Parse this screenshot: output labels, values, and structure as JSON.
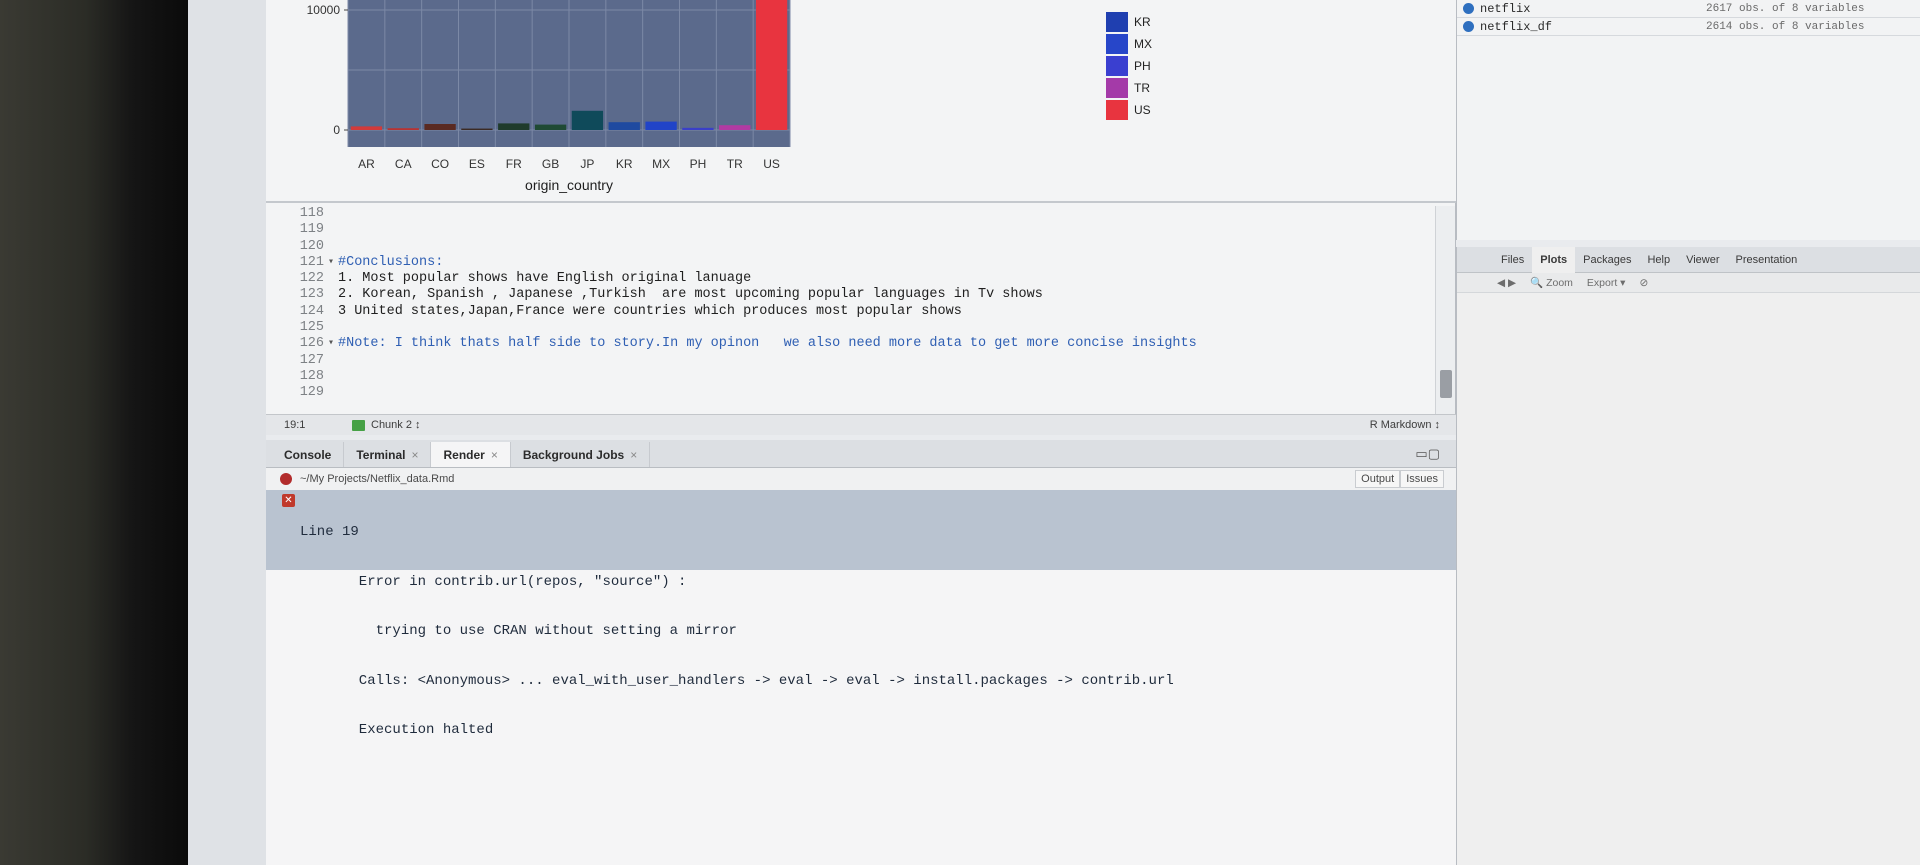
{
  "plot": {
    "y_ticks": [
      "10000",
      "0"
    ],
    "x_label": "origin_country",
    "legend": [
      {
        "code": "KR",
        "color": "#1f3fb0"
      },
      {
        "code": "MX",
        "color": "#2746c9"
      },
      {
        "code": "PH",
        "color": "#3a3fd0"
      },
      {
        "code": "TR",
        "color": "#a43aa8"
      },
      {
        "code": "US",
        "color": "#e8343f"
      }
    ]
  },
  "chart_data": {
    "type": "bar",
    "categories": [
      "AR",
      "CA",
      "CO",
      "ES",
      "FR",
      "GB",
      "JP",
      "KR",
      "MX",
      "PH",
      "TR",
      "US"
    ],
    "values": [
      300,
      150,
      500,
      120,
      550,
      450,
      1600,
      650,
      700,
      180,
      400,
      19000
    ],
    "colors": [
      "#d33a3a",
      "#b83333",
      "#5a2a22",
      "#3b2a24",
      "#1f3b2c",
      "#1f4a34",
      "#0f4a5a",
      "#1f4aa0",
      "#2144c8",
      "#3a3fc8",
      "#b23aa3",
      "#e8343f"
    ],
    "xlabel": "origin_country",
    "ylabel": "",
    "y_ticks": [
      0,
      10000
    ],
    "ylim": [
      0,
      20000
    ],
    "grid": true,
    "legend_position": "right"
  },
  "editor": {
    "lines": [
      {
        "num": "118",
        "fold": "",
        "text": "",
        "style": "plain"
      },
      {
        "num": "119",
        "fold": "",
        "text": "",
        "style": "plain"
      },
      {
        "num": "120",
        "fold": "",
        "text": "",
        "style": "plain"
      },
      {
        "num": "121",
        "fold": "▾",
        "text": "#Conclusions:",
        "style": "comment"
      },
      {
        "num": "122",
        "fold": "",
        "text": "1. Most popular shows have English original lanuage",
        "style": "plain"
      },
      {
        "num": "123",
        "fold": "",
        "text": "2. Korean, Spanish , Japanese ,Turkish  are most upcoming popular languages in Tv shows",
        "style": "plain"
      },
      {
        "num": "124",
        "fold": "",
        "text": "3 United states,Japan,France were countries which produces most popular shows",
        "style": "plain"
      },
      {
        "num": "125",
        "fold": "",
        "text": "",
        "style": "plain"
      },
      {
        "num": "126",
        "fold": "▾",
        "text": "#Note: I think thats half side to story.In my opinon   we also need more data to get more concise insights",
        "style": "comment"
      },
      {
        "num": "127",
        "fold": "",
        "text": "",
        "style": "plain"
      },
      {
        "num": "128",
        "fold": "",
        "text": "",
        "style": "plain"
      },
      {
        "num": "129",
        "fold": "",
        "text": "",
        "style": "plain"
      }
    ],
    "status_position": "19:1",
    "status_chunk": "Chunk 2 ↕",
    "status_language": "R Markdown ↕"
  },
  "console": {
    "tabs": [
      {
        "label": "Console",
        "closable": false
      },
      {
        "label": "Terminal",
        "closable": true
      },
      {
        "label": "Render",
        "closable": true
      },
      {
        "label": "Background Jobs",
        "closable": true
      }
    ],
    "active_tab": "Render",
    "render_path": "~/My Projects/Netflix_data.Rmd",
    "output_btn": "Output",
    "issues_btn": "Issues",
    "error_lines": [
      "Line 19",
      "       Error in contrib.url(repos, \"source\") :",
      "         trying to use CRAN without setting a mirror",
      "       Calls: <Anonymous> ... eval_with_user_handlers -> eval -> eval -> install.packages -> contrib.url",
      "       Execution halted"
    ]
  },
  "environment": {
    "rows": [
      {
        "name": "netflix",
        "value": "2617 obs. of 8 variables"
      },
      {
        "name": "netflix_df",
        "value": "2614 obs. of 8 variables"
      }
    ]
  },
  "files_pane": {
    "tabs": [
      "Files",
      "Plots",
      "Packages",
      "Help",
      "Viewer",
      "Presentation"
    ],
    "active_tab": "Plots",
    "toolbar": [
      "Zoom",
      "Export ▾"
    ]
  }
}
